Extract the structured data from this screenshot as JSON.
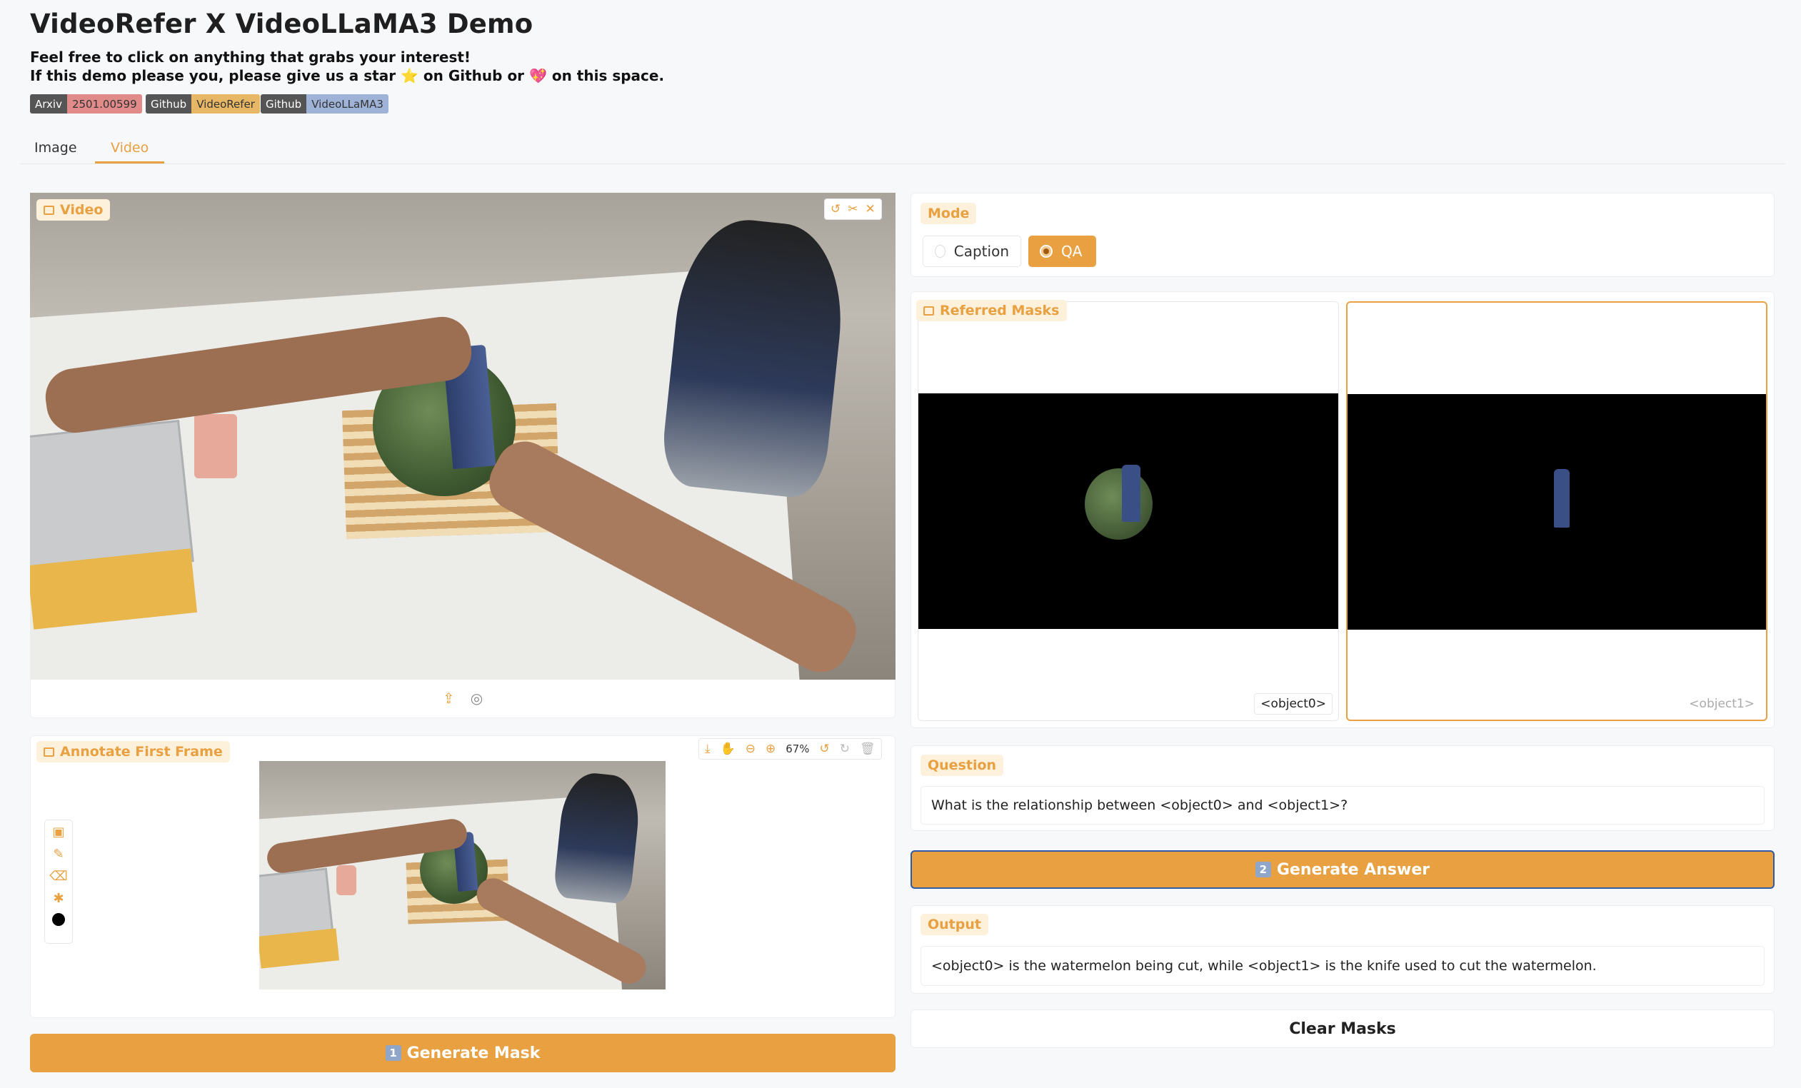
{
  "header": {
    "title": "VideoRefer X VideoLLaMA3 Demo",
    "line1": "Feel free to click on anything that grabs your interest!",
    "line2": "If this demo please you, please give us a star ⭐ on Github or 💖 on this space.",
    "badges": [
      {
        "key": "Arxiv",
        "value": "2501.00599",
        "color": "#e08a8a"
      },
      {
        "key": "Github",
        "value": "VideoRefer",
        "color": "#e7b765"
      },
      {
        "key": "Github",
        "value": "VideoLLaMA3",
        "color": "#9fb3d9"
      }
    ]
  },
  "tabs": [
    {
      "label": "Image"
    },
    {
      "label": "Video",
      "active": true
    }
  ],
  "video_panel": {
    "label": "Video",
    "top_tools": [
      "undo-icon",
      "scissors-icon",
      "close-icon"
    ],
    "bottom_tools": [
      "upload-icon",
      "webcam-icon"
    ]
  },
  "annotate_panel": {
    "label": "Annotate First Frame",
    "zoom": "67%",
    "left_tools": [
      "image-icon",
      "brush-icon",
      "eraser-icon",
      "palette-icon",
      "color-dot-icon"
    ]
  },
  "generate_mask_button": {
    "number": "1",
    "label": "Generate Mask"
  },
  "mode": {
    "label": "Mode",
    "options": [
      "Caption",
      "QA"
    ],
    "selected": "QA"
  },
  "referred_masks": {
    "label": "Referred Masks",
    "items": [
      {
        "caption": "<object0>"
      },
      {
        "caption": "<object1>"
      }
    ]
  },
  "question": {
    "label": "Question",
    "value": "What is the relationship between <object0> and <object1>?"
  },
  "generate_answer_button": {
    "number": "2",
    "label": "Generate Answer"
  },
  "output": {
    "label": "Output",
    "value": "<object0> is the watermelon being cut, while <object1> is the knife used to cut the watermelon."
  },
  "clear_button": {
    "label": "Clear Masks"
  },
  "colors": {
    "accent": "#e8a040",
    "accent_light": "#fdf1dc"
  }
}
